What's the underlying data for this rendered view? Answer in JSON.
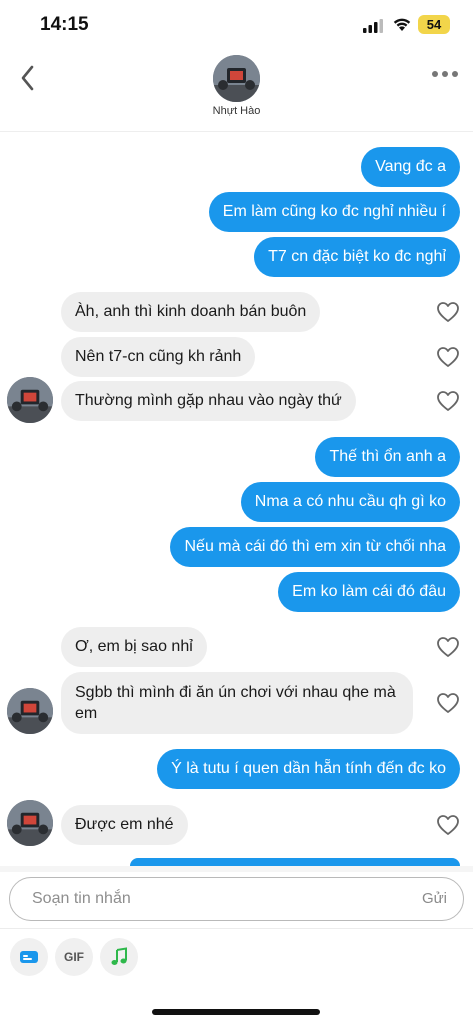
{
  "status_bar": {
    "time": "14:15",
    "battery": "54"
  },
  "header": {
    "contact_name": "Nhựt Hào",
    "avatar_icon": "contact-avatar"
  },
  "messages": [
    {
      "direction": "sent",
      "text": "Vang đc a"
    },
    {
      "direction": "sent",
      "text": "Em làm cũng ko đc nghỉ nhiều í"
    },
    {
      "direction": "sent",
      "text": "T7 cn đặc biệt ko đc nghỉ"
    },
    {
      "direction": "received",
      "text": "Àh, anh thì kinh doanh bán buôn"
    },
    {
      "direction": "received",
      "text": "Nên t7-cn cũng kh rảnh"
    },
    {
      "direction": "received",
      "text": "Thường mình gặp nhau vào ngày thứ"
    },
    {
      "direction": "sent",
      "text": "Thế thì ổn anh a"
    },
    {
      "direction": "sent",
      "text": "Nma a có nhu cầu qh gì ko"
    },
    {
      "direction": "sent",
      "text": "Nếu mà cái đó thì em xin từ chối nha"
    },
    {
      "direction": "sent",
      "text": "Em ko làm cái đó đâu"
    },
    {
      "direction": "received",
      "text": "Ơ, em bị sao nhỉ"
    },
    {
      "direction": "received",
      "text": "Sgbb thì mình đi ăn ún chơi với nhau qhe mà em"
    },
    {
      "direction": "sent",
      "text": "Ý là tutu í quen dần hẵn tính đến đc ko"
    },
    {
      "direction": "received",
      "text": "Được em nhé"
    }
  ],
  "composer": {
    "placeholder": "Soạn tin nhắn",
    "send_label": "Gửi"
  },
  "toolbar": {
    "gif_label": "GIF",
    "icons": [
      "card-icon",
      "gif-icon",
      "music-note-icon"
    ]
  },
  "colors": {
    "sent_bubble": "#1a97ec",
    "received_bubble": "#eeeeee",
    "battery": "#f2d54a"
  }
}
